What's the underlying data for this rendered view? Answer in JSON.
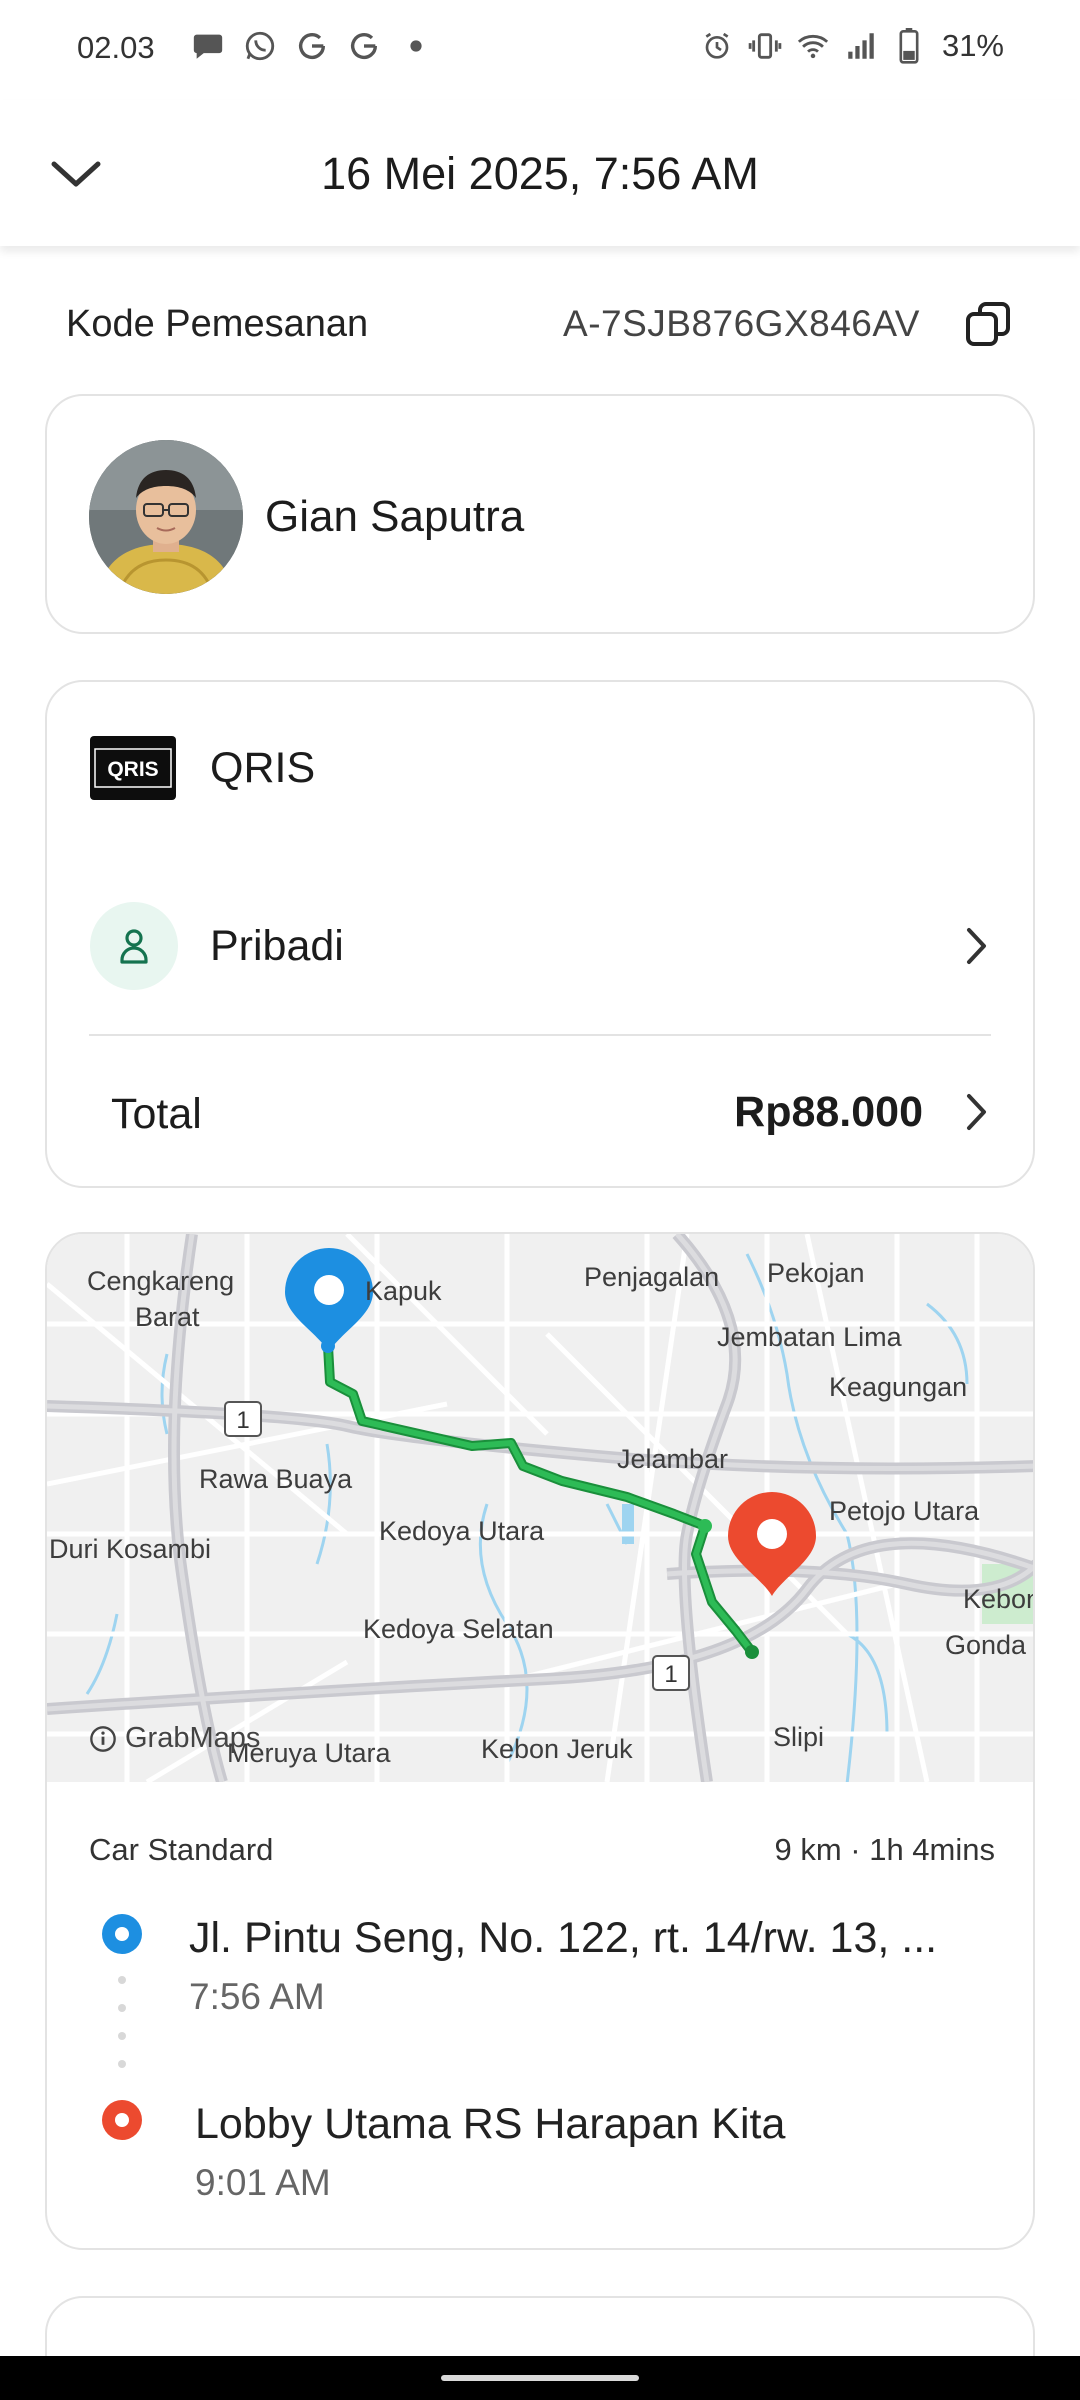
{
  "status_bar": {
    "time": "02.03",
    "battery": "31%",
    "notification_icons": [
      "chat-bubble-icon",
      "whatsapp-icon",
      "google-icon",
      "google-icon",
      "dot-icon"
    ],
    "system_icons": [
      "alarm-icon",
      "vibrate-icon",
      "wifi-icon",
      "signal-icon",
      "battery-icon"
    ]
  },
  "header": {
    "title": "16 Mei 2025, 7:56 AM"
  },
  "booking": {
    "label": "Kode Pemesanan",
    "code": "A-7SJB876GX846AV"
  },
  "driver": {
    "name": "Gian Saputra"
  },
  "payment": {
    "logo_text": "QRIS",
    "method": "QRIS",
    "profile": "Pribadi",
    "total_label": "Total",
    "total_value": "Rp88.000"
  },
  "map": {
    "labels": {
      "cengkareng": "Cengkareng",
      "barat": "Barat",
      "kapuk": "Kapuk",
      "penjagalan": "Penjagalan",
      "pekojan": "Pekojan",
      "jembatan_lima": "Jembatan Lima",
      "keagungan": "Keagungan",
      "rawa_buaya": "Rawa Buaya",
      "jelambar": "Jelambar",
      "petojo_utara": "Petojo Utara",
      "duri_kosambi": "Duri Kosambi",
      "kedoya_utara": "Kedoya Utara",
      "kedoya_selatan": "Kedoya Selatan",
      "kebon": "Kebon",
      "gonda": "Gonda",
      "meruya_utara": "Meruya Utara",
      "kebon_jeruk": "Kebon Jeruk",
      "slipi": "Slipi",
      "road_1a": "1",
      "road_1b": "1"
    },
    "attribution": "GrabMaps",
    "route_color": "#1fa84a",
    "pickup_pin_color": "#1d8fe1",
    "dropoff_pin_color": "#ec4a2f"
  },
  "trip": {
    "vehicle": "Car Standard",
    "distance_duration": "9 km · 1h 4mins",
    "pickup": {
      "address": "Jl. Pintu Seng, No. 122, rt. 14/rw. 13, ...",
      "time": "7:56 AM"
    },
    "dropoff": {
      "address": "Lobby Utama RS Harapan Kita",
      "time": "9:01 AM"
    }
  }
}
